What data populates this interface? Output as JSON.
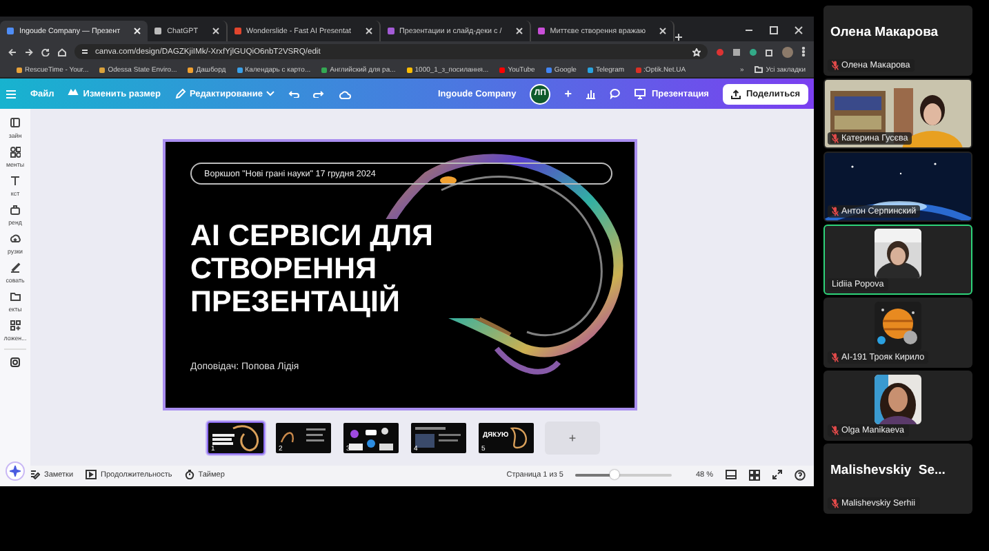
{
  "browser": {
    "tabs": [
      {
        "title": "Ingoude Company — Презент",
        "selected": true,
        "color": "#4f8df5"
      },
      {
        "title": "ChatGPT",
        "selected": false,
        "color": "#bbbbbb"
      },
      {
        "title": "Wonderslide - Fast AI Presentat",
        "selected": false,
        "color": "#e2452d"
      },
      {
        "title": "Презентации и слайд-деки с /",
        "selected": false,
        "color": "#a35bd6"
      },
      {
        "title": "Миттєве створення вражаю",
        "selected": false,
        "color": "#c94fd8"
      }
    ],
    "address": "canva.com/design/DAGZKjiIMk/-XrxfYjlGUQiO6nbT2VSRQ/edit",
    "bookmarks": [
      {
        "label": "RescueTime - Your...",
        "color": "#e8a23a"
      },
      {
        "label": "Odessa State Enviro...",
        "color": "#d9a13c"
      },
      {
        "label": "Дашборд",
        "color": "#f0a030"
      },
      {
        "label": "Календарь с карто...",
        "color": "#3aa0e8"
      },
      {
        "label": "Английский для ра...",
        "color": "#34a853"
      },
      {
        "label": "1000_1_з_посилання...",
        "color": "#fbbc04"
      },
      {
        "label": "YouTube",
        "color": "#ff0000"
      },
      {
        "label": "Google",
        "color": "#4285f4"
      },
      {
        "label": "Telegram",
        "color": "#2aa3df"
      },
      {
        "label": ":Optik.Net.UA",
        "color": "#d93025"
      }
    ],
    "bookmarks_more": "»",
    "all_bookmarks": "Усі закладки"
  },
  "editor": {
    "menu": [
      "Файл",
      "Изменить размер",
      "Редактирование"
    ],
    "team": "Ingoude Company",
    "avatar": "ЛП",
    "add_member": "+",
    "present": "Презентация",
    "share": "Поделиться",
    "sidebar": [
      {
        "label": "зайн"
      },
      {
        "label": "менты"
      },
      {
        "label": "кст"
      },
      {
        "label": "ренд"
      },
      {
        "label": "рузки"
      },
      {
        "label": "совать"
      },
      {
        "label": "екты"
      },
      {
        "label": "ложен..."
      }
    ],
    "slide": {
      "tag": "Воркшоп \"Нові грані науки\" 17 грудня 2024",
      "title": "AI СЕРВІСИ ДЛЯ СТВОРЕННЯ ПРЕЗЕНТАЦІЙ",
      "speaker": "Доповідач: Попова Лідія"
    },
    "thumbnails": [
      {
        "number": "1",
        "selected": true
      },
      {
        "number": "2",
        "selected": false
      },
      {
        "number": "3",
        "selected": false
      },
      {
        "number": "4",
        "selected": false
      },
      {
        "number": "5",
        "selected": false,
        "caption": "ДЯКУЮ"
      }
    ],
    "add_page": "+",
    "footer": {
      "notes": "Заметки",
      "duration": "Продолжительность",
      "timer": "Таймер",
      "page": "Страница 1 из 5",
      "zoom": {
        "level": 0.4
      },
      "zoom_reading": "48 %"
    }
  },
  "participants": [
    {
      "kind": "name",
      "name": "Олена Макарова",
      "label": "Олена Макарова",
      "muted": true,
      "active": false
    },
    {
      "kind": "video",
      "label": "Катерина Гусєва",
      "muted": true,
      "active": false
    },
    {
      "kind": "video",
      "label": "Антон Серпинский",
      "muted": true,
      "active": false
    },
    {
      "kind": "avatar",
      "label": "Lidiia Popova",
      "muted": false,
      "active": true
    },
    {
      "kind": "avatar",
      "label": "AI-191 Трояк Кирило",
      "muted": true,
      "active": false
    },
    {
      "kind": "avatar",
      "label": "Olga Manikaeva",
      "muted": true,
      "active": false
    },
    {
      "kind": "name",
      "name": "Malishevskiy  Se...",
      "label": "Malishevskiy Serhii",
      "muted": true,
      "active": false
    }
  ]
}
